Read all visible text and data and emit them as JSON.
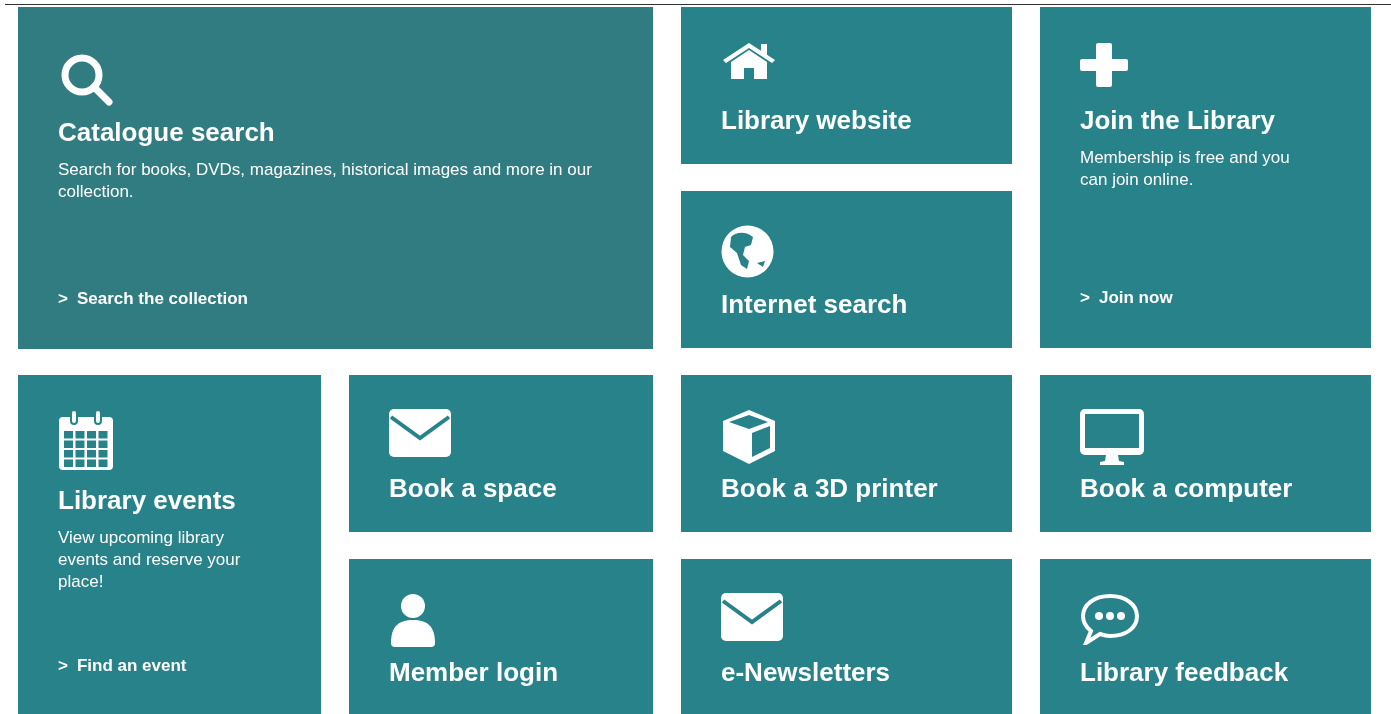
{
  "tiles": [
    {
      "kind": "large",
      "color": "#317c80",
      "title": "Catalogue search",
      "description": "Search for books, DVDs, magazines, historical images and more in our collection.",
      "link": {
        "chevron": ">",
        "label": "Search the collection"
      }
    },
    {
      "kind": "small",
      "color": "#28828a",
      "title": "Library website"
    },
    {
      "kind": "tall",
      "color": "#28828a",
      "title": "Join the Library",
      "description": "Membership is free and you can join online.",
      "link": {
        "chevron": ">",
        "label": "Join now"
      }
    },
    {
      "kind": "small",
      "color": "#28828a",
      "title": "Internet search"
    },
    {
      "kind": "tall",
      "color": "#28828a",
      "title": "Library events",
      "description": "View upcoming library events and reserve your place!",
      "link": {
        "chevron": ">",
        "label": "Find an event"
      }
    },
    {
      "kind": "small",
      "color": "#28828a",
      "title": "Book a space"
    },
    {
      "kind": "small",
      "color": "#28828a",
      "title": "Book a 3D printer"
    },
    {
      "kind": "small",
      "color": "#28828a",
      "title": "Book a computer"
    },
    {
      "kind": "small",
      "color": "#28828a",
      "title": "Member login"
    },
    {
      "kind": "small",
      "color": "#28828a",
      "title": "e-Newsletters"
    },
    {
      "kind": "small",
      "color": "#28828a",
      "title": "Library feedback"
    }
  ]
}
